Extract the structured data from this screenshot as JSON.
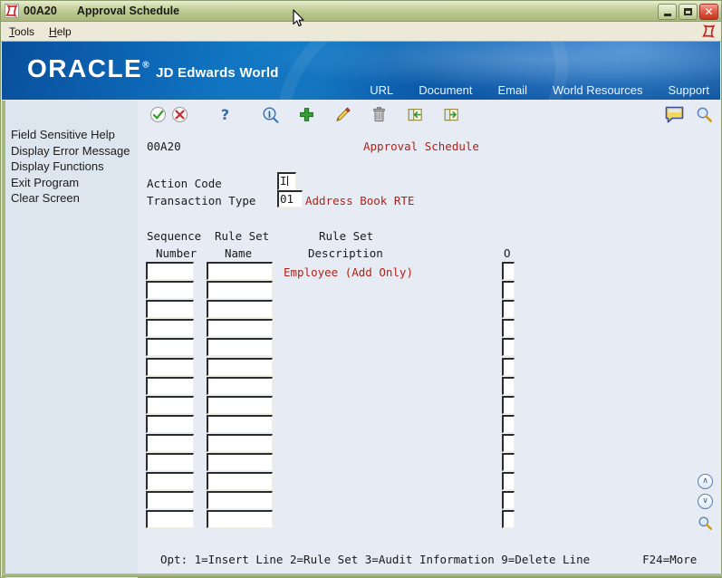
{
  "window": {
    "icon_name": "jde-app-icon",
    "program_id": "00A20",
    "title": "Approval Schedule",
    "minimize_label": "Minimize",
    "maximize_label": "Maximize",
    "close_label": "✕"
  },
  "menubar": {
    "items": [
      {
        "label": "Tools",
        "accel": "T"
      },
      {
        "label": "Help",
        "accel": "H"
      }
    ],
    "logo_name": "jde-menu-logo"
  },
  "banner": {
    "brand": "ORACLE",
    "brand_mark": "®",
    "product": "JD Edwards World",
    "nav": [
      "URL",
      "Document",
      "Email",
      "World Resources",
      "Support"
    ],
    "bg_color": "#0d69b8"
  },
  "toolbar": {
    "icons": [
      {
        "name": "ok-check-icon",
        "title": "OK"
      },
      {
        "name": "cancel-x-icon",
        "title": "Cancel"
      },
      {
        "name": "help-question-icon",
        "title": "Help"
      },
      {
        "name": "info-search-icon",
        "title": "Information"
      },
      {
        "name": "add-plus-icon",
        "title": "Add"
      },
      {
        "name": "edit-pencil-icon",
        "title": "Change"
      },
      {
        "name": "delete-trash-icon",
        "title": "Delete"
      },
      {
        "name": "import-icon",
        "title": "Import"
      },
      {
        "name": "export-icon",
        "title": "Export"
      }
    ],
    "right_icons": [
      {
        "name": "note-bubble-icon",
        "title": "Notes"
      },
      {
        "name": "magnifier-icon",
        "title": "Find"
      }
    ]
  },
  "sidebar": {
    "items": [
      "Field Sensitive Help",
      "Display Error Message",
      "Display Functions",
      "Exit Program",
      "Clear Screen"
    ]
  },
  "form": {
    "screen_id": "00A20",
    "screen_title": "Approval Schedule",
    "fields": [
      {
        "label": "Action Code",
        "value": "I"
      },
      {
        "label": "Transaction Type",
        "value": "01",
        "description": "Address Book RTE"
      }
    ],
    "columns": [
      {
        "line1": "Sequence",
        "line2": "Number"
      },
      {
        "line1": "Rule Set",
        "line2": "Name"
      },
      {
        "line1": "Rule Set",
        "line2": "Description"
      },
      {
        "line1": "",
        "line2": "O"
      }
    ],
    "rows": [
      {
        "sequence": "",
        "rule_set_name": "",
        "description": "Employee (Add Only)",
        "opt": ""
      },
      {
        "sequence": "",
        "rule_set_name": "",
        "description": "",
        "opt": ""
      },
      {
        "sequence": "",
        "rule_set_name": "",
        "description": "",
        "opt": ""
      },
      {
        "sequence": "",
        "rule_set_name": "",
        "description": "",
        "opt": ""
      },
      {
        "sequence": "",
        "rule_set_name": "",
        "description": "",
        "opt": ""
      },
      {
        "sequence": "",
        "rule_set_name": "",
        "description": "",
        "opt": ""
      },
      {
        "sequence": "",
        "rule_set_name": "",
        "description": "",
        "opt": ""
      },
      {
        "sequence": "",
        "rule_set_name": "",
        "description": "",
        "opt": ""
      },
      {
        "sequence": "",
        "rule_set_name": "",
        "description": "",
        "opt": ""
      },
      {
        "sequence": "",
        "rule_set_name": "",
        "description": "",
        "opt": ""
      },
      {
        "sequence": "",
        "rule_set_name": "",
        "description": "",
        "opt": ""
      },
      {
        "sequence": "",
        "rule_set_name": "",
        "description": "",
        "opt": ""
      },
      {
        "sequence": "",
        "rule_set_name": "",
        "description": "",
        "opt": ""
      },
      {
        "sequence": "",
        "rule_set_name": "",
        "description": "",
        "opt": ""
      }
    ],
    "status": {
      "options": "Opt: 1=Insert Line 2=Rule Set 3=Audit Information 9=Delete Line",
      "more_key": "F24=More"
    }
  },
  "nav_buttons": [
    {
      "name": "page-up-button",
      "glyph": "∧"
    },
    {
      "name": "page-down-button",
      "glyph": "∨"
    },
    {
      "name": "find-button",
      "glyph": "magnifier"
    }
  ],
  "colors": {
    "accent_red": "#b02318",
    "banner_blue": "#0d69b8",
    "window_chrome": "#b9c68d",
    "content_bg": "#e7ebf4",
    "sidebar_bg": "#dde6ee"
  }
}
